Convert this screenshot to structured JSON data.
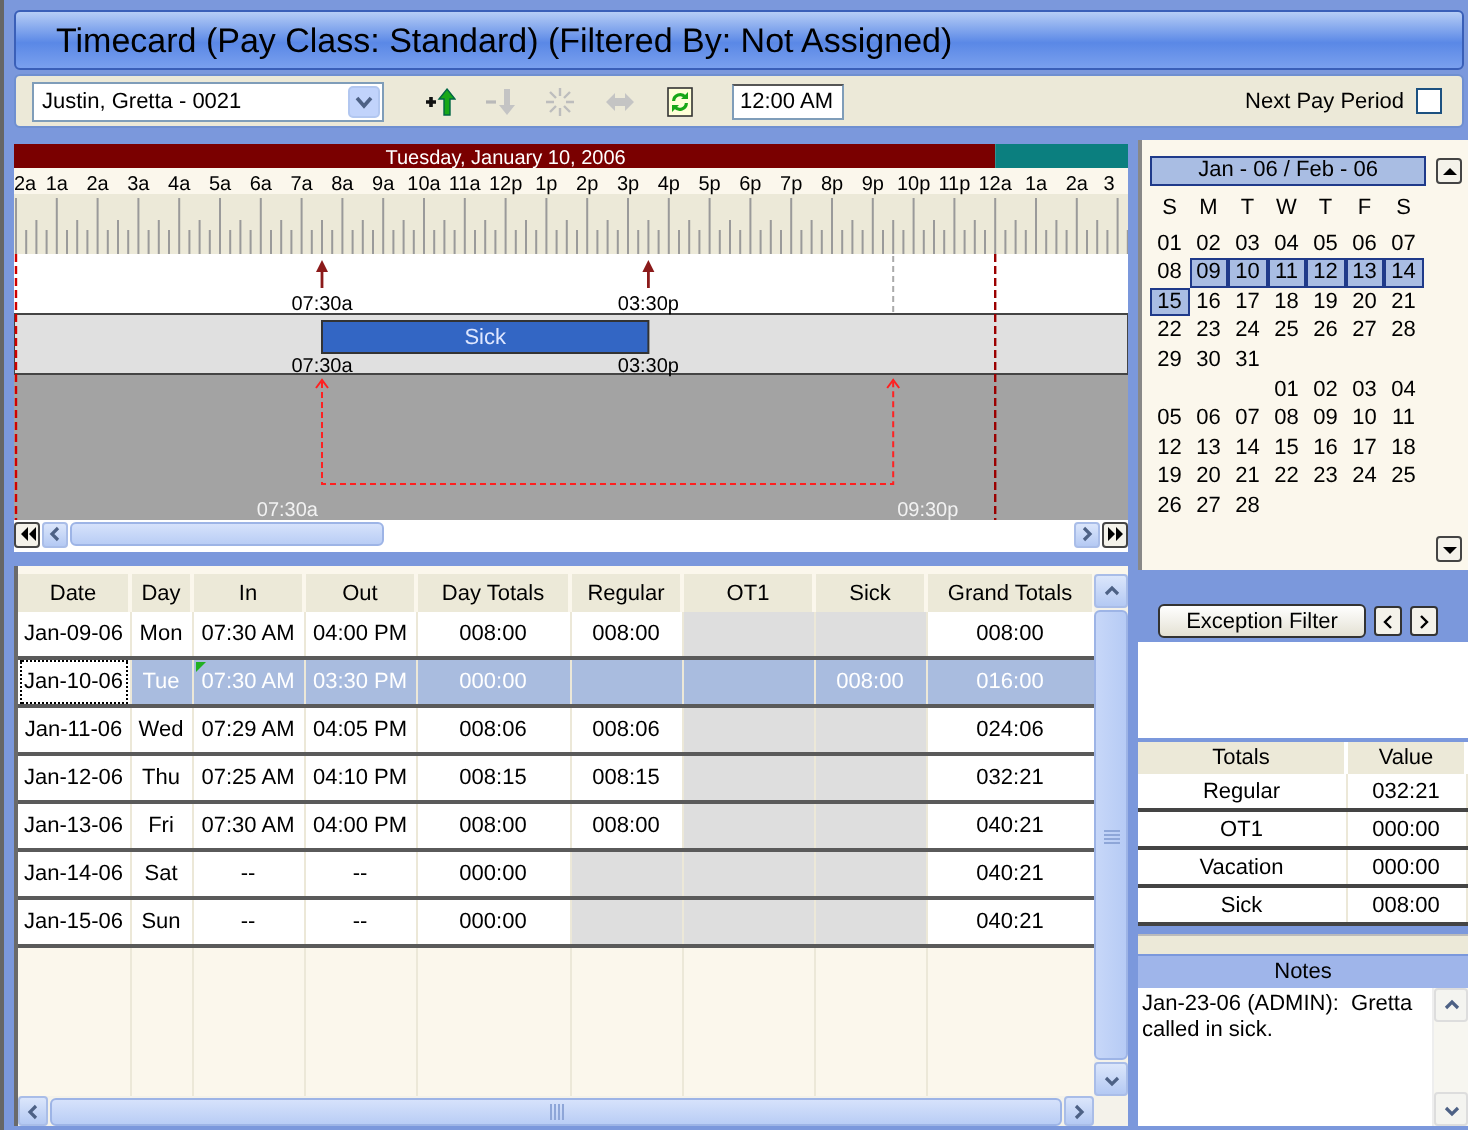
{
  "window": {
    "title": "Timecard (Pay Class: Standard) (Filtered By: Not Assigned)"
  },
  "toolbar": {
    "employee": "Justin, Gretta - 0021",
    "tools": [
      {
        "kind": "add-punch",
        "disabled": false
      },
      {
        "kind": "move-down",
        "disabled": true
      },
      {
        "kind": "burst",
        "disabled": true
      },
      {
        "kind": "swap",
        "disabled": true
      },
      {
        "kind": "refresh",
        "disabled": false
      }
    ],
    "time": "12:00 AM",
    "next_pay_period": {
      "label": "Next Pay Period",
      "checked": false
    }
  },
  "timeline": {
    "date": "Tuesday, January 10, 2006",
    "hours": [
      "2a",
      "1a",
      "2a",
      "3a",
      "4a",
      "5a",
      "6a",
      "7a",
      "8a",
      "9a",
      "10a",
      "11a",
      "12p",
      "1p",
      "2p",
      "3p",
      "4p",
      "5p",
      "6p",
      "7p",
      "8p",
      "9p",
      "10p",
      "11p",
      "12a",
      "1a",
      "2a",
      "3"
    ],
    "punches": [
      {
        "time": "07:30a"
      },
      {
        "time": "03:30p"
      }
    ],
    "absence": {
      "label": "Sick",
      "start": "07:30a",
      "end": "03:30p"
    },
    "schedule": {
      "start": "07:30a",
      "end": "09:30p"
    }
  },
  "grid": {
    "columns": [
      "Date",
      "Day",
      "In",
      "Out",
      "Day Totals",
      "Regular",
      "OT1",
      "Sick",
      "Grand Totals"
    ],
    "rows": [
      {
        "selected": false,
        "note_marker": false,
        "cells": [
          "Jan-09-06",
          "Mon",
          "07:30 AM",
          "04:00 PM",
          "008:00",
          "008:00",
          null,
          null,
          "008:00"
        ]
      },
      {
        "selected": true,
        "note_marker": true,
        "cells": [
          "Jan-10-06",
          "Tue",
          "07:30 AM",
          "03:30 PM",
          "000:00",
          null,
          null,
          "008:00",
          "016:00"
        ]
      },
      {
        "selected": false,
        "note_marker": false,
        "cells": [
          "Jan-11-06",
          "Wed",
          "07:29 AM",
          "04:05 PM",
          "008:06",
          "008:06",
          null,
          null,
          "024:06"
        ]
      },
      {
        "selected": false,
        "note_marker": false,
        "cells": [
          "Jan-12-06",
          "Thu",
          "07:25 AM",
          "04:10 PM",
          "008:15",
          "008:15",
          null,
          null,
          "032:21"
        ]
      },
      {
        "selected": false,
        "note_marker": false,
        "cells": [
          "Jan-13-06",
          "Fri",
          "07:30 AM",
          "04:00 PM",
          "008:00",
          "008:00",
          null,
          null,
          "040:21"
        ]
      },
      {
        "selected": false,
        "note_marker": false,
        "cells": [
          "Jan-14-06",
          "Sat",
          "--",
          "--",
          "000:00",
          null,
          null,
          null,
          "040:21"
        ]
      },
      {
        "selected": false,
        "note_marker": false,
        "cells": [
          "Jan-15-06",
          "Sun",
          "--",
          "--",
          "000:00",
          null,
          null,
          null,
          "040:21"
        ]
      }
    ]
  },
  "calendar": {
    "title": "Jan - 06 / Feb - 06",
    "weekdays": [
      "S",
      "M",
      "T",
      "W",
      "T",
      "F",
      "S"
    ],
    "months": [
      {
        "weeks": [
          [
            {
              "label": "01",
              "selected": false
            },
            {
              "label": "02",
              "selected": false
            },
            {
              "label": "03",
              "selected": false
            },
            {
              "label": "04",
              "selected": false
            },
            {
              "label": "05",
              "selected": false
            },
            {
              "label": "06",
              "selected": false
            },
            {
              "label": "07",
              "selected": false
            }
          ],
          [
            {
              "label": "08",
              "selected": false
            },
            {
              "label": "09",
              "selected": true
            },
            {
              "label": "10",
              "selected": true
            },
            {
              "label": "11",
              "selected": true
            },
            {
              "label": "12",
              "selected": true
            },
            {
              "label": "13",
              "selected": true
            },
            {
              "label": "14",
              "selected": true
            }
          ],
          [
            {
              "label": "15",
              "selected": true
            },
            {
              "label": "16",
              "selected": false
            },
            {
              "label": "17",
              "selected": false
            },
            {
              "label": "18",
              "selected": false
            },
            {
              "label": "19",
              "selected": false
            },
            {
              "label": "20",
              "selected": false
            },
            {
              "label": "21",
              "selected": false
            }
          ],
          [
            {
              "label": "22",
              "selected": false
            },
            {
              "label": "23",
              "selected": false
            },
            {
              "label": "24",
              "selected": false
            },
            {
              "label": "25",
              "selected": false
            },
            {
              "label": "26",
              "selected": false
            },
            {
              "label": "27",
              "selected": false
            },
            {
              "label": "28",
              "selected": false
            }
          ],
          {
            "aligned_right": false,
            "days": [
              {
                "label": "29",
                "selected": false
              },
              {
                "label": "30",
                "selected": false
              },
              {
                "label": "31",
                "selected": false
              }
            ]
          }
        ]
      },
      {
        "weeks": [
          {
            "aligned_right": true,
            "days": [
              {
                "label": "01",
                "selected": false
              },
              {
                "label": "02",
                "selected": false
              },
              {
                "label": "03",
                "selected": false
              },
              {
                "label": "04",
                "selected": false
              }
            ]
          },
          [
            {
              "label": "05",
              "selected": false
            },
            {
              "label": "06",
              "selected": false
            },
            {
              "label": "07",
              "selected": false
            },
            {
              "label": "08",
              "selected": false
            },
            {
              "label": "09",
              "selected": false
            },
            {
              "label": "10",
              "selected": false
            },
            {
              "label": "11",
              "selected": false
            }
          ],
          [
            {
              "label": "12",
              "selected": false
            },
            {
              "label": "13",
              "selected": false
            },
            {
              "label": "14",
              "selected": false
            },
            {
              "label": "15",
              "selected": false
            },
            {
              "label": "16",
              "selected": false
            },
            {
              "label": "17",
              "selected": false
            },
            {
              "label": "18",
              "selected": false
            }
          ],
          [
            {
              "label": "19",
              "selected": false
            },
            {
              "label": "20",
              "selected": false
            },
            {
              "label": "21",
              "selected": false
            },
            {
              "label": "22",
              "selected": false
            },
            {
              "label": "23",
              "selected": false
            },
            {
              "label": "24",
              "selected": false
            },
            {
              "label": "25",
              "selected": false
            }
          ],
          {
            "aligned_right": false,
            "days": [
              {
                "label": "26",
                "selected": false
              },
              {
                "label": "27",
                "selected": false
              },
              {
                "label": "28",
                "selected": false
              }
            ]
          }
        ]
      }
    ]
  },
  "exception_filter": {
    "button": "Exception Filter"
  },
  "totals": {
    "columns": [
      "Totals",
      "Value"
    ],
    "rows": [
      [
        "Regular",
        "032:21"
      ],
      [
        "OT1",
        "000:00"
      ],
      [
        "Vacation",
        "000:00"
      ],
      [
        "Sick",
        "008:00"
      ]
    ]
  },
  "notes": {
    "title": "Notes",
    "text": "Jan-23-06 (ADMIN):  Gretta called in sick."
  }
}
